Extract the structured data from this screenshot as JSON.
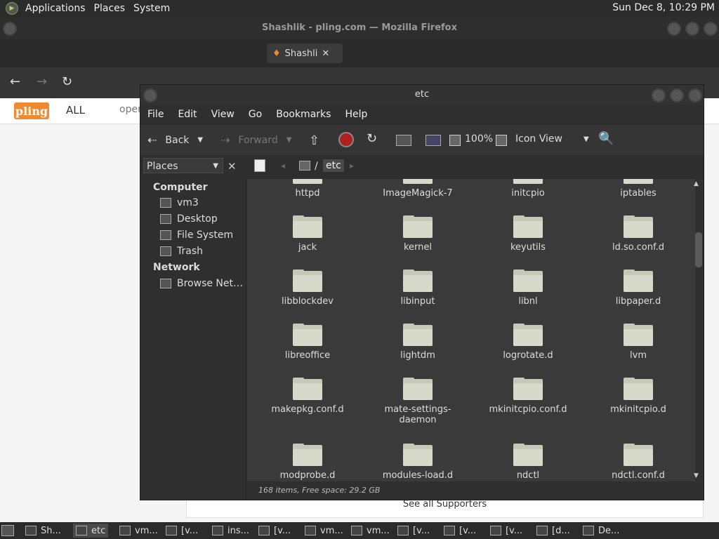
{
  "top_panel": {
    "menus": [
      "Applications",
      "Places",
      "System"
    ],
    "clock": "Sun Dec  8, 10:29 PM"
  },
  "firefox": {
    "title": "Shashlik - pling.com — Mozilla Firefox",
    "active_tab": "Shashli",
    "site": {
      "logo": "pling",
      "filter": "ALL",
      "nav_text": "oper",
      "see_all": "See all Supporters"
    }
  },
  "file_manager": {
    "title": "etc",
    "menu": [
      "File",
      "Edit",
      "View",
      "Go",
      "Bookmarks",
      "Help"
    ],
    "toolbar": {
      "back": "Back",
      "forward": "Forward",
      "zoom": "100%",
      "view_mode": "Icon View"
    },
    "places_label": "Places",
    "breadcrumb": [
      "/",
      "etc"
    ],
    "sidebar": {
      "computer_head": "Computer",
      "computer_items": [
        "vm3",
        "Desktop",
        "File System",
        "Trash"
      ],
      "network_head": "Network",
      "network_items": [
        "Browse Net…"
      ]
    },
    "folders": [
      [
        "httpd",
        "ImageMagick-7",
        "initcpio",
        "iptables"
      ],
      [
        "jack",
        "kernel",
        "keyutils",
        "ld.so.conf.d"
      ],
      [
        "libblockdev",
        "libinput",
        "libnl",
        "libpaper.d"
      ],
      [
        "libreoffice",
        "lightdm",
        "logrotate.d",
        "lvm"
      ],
      [
        "makepkg.conf.d",
        "mate-settings-daemon",
        "mkinitcpio.conf.d",
        "mkinitcpio.d"
      ],
      [
        "modprobe.d",
        "modules-load.d",
        "ndctl",
        "ndctl.conf.d"
      ]
    ],
    "status": "168 items, Free space: 29.2 GB"
  },
  "taskbar": {
    "tasks": [
      "Sh...",
      "etc",
      "vm...",
      "[v...",
      "ins...",
      "[v...",
      "vm...",
      "vm...",
      "[v...",
      "[v...",
      "[v...",
      "[d...",
      "De..."
    ]
  }
}
